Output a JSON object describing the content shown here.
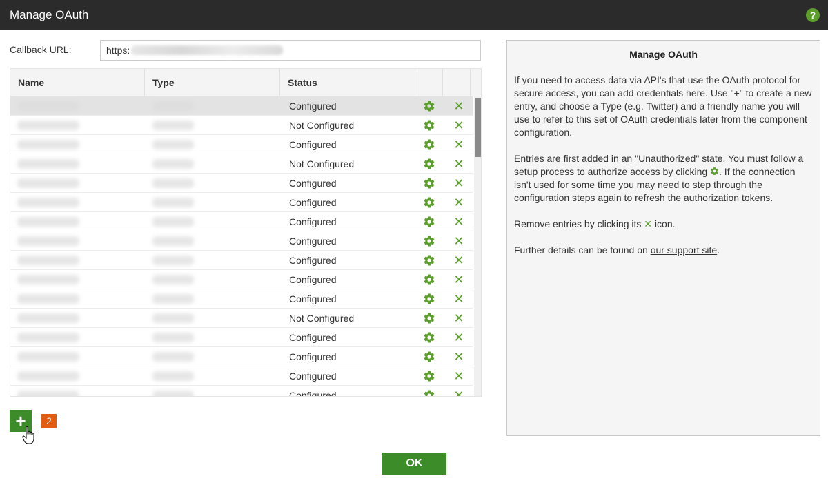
{
  "dialog": {
    "title": "Manage OAuth"
  },
  "callback": {
    "label": "Callback URL:",
    "value": "https:"
  },
  "grid": {
    "columns": [
      "Name",
      "Type",
      "Status"
    ],
    "rows": [
      {
        "status": "Configured",
        "selected": true
      },
      {
        "status": "Not Configured"
      },
      {
        "status": "Configured"
      },
      {
        "status": "Not Configured"
      },
      {
        "status": "Configured"
      },
      {
        "status": "Configured"
      },
      {
        "status": "Configured"
      },
      {
        "status": "Configured"
      },
      {
        "status": "Configured"
      },
      {
        "status": "Configured"
      },
      {
        "status": "Configured"
      },
      {
        "status": "Not Configured"
      },
      {
        "status": "Configured"
      },
      {
        "status": "Configured"
      },
      {
        "status": "Configured"
      },
      {
        "status": "Configured"
      }
    ]
  },
  "badge": {
    "count": "2"
  },
  "help": {
    "title": "Manage OAuth",
    "p1": "If you need to access data via API's that use the OAuth protocol for secure access, you can add credentials here. Use \"+\" to create a new entry, and choose a Type (e.g. Twitter) and a friendly name you will use to refer to this set of OAuth credentials later from the component configuration.",
    "p2_before": "Entries are first added in an \"Unauthorized\" state. You must follow a setup process to authorize access by clicking",
    "p2_after": ". If the connection isn't used for some time you may need to step through the configuration steps again to refresh the authorization tokens.",
    "p3_before": "Remove entries by clicking its",
    "p3_after": "icon.",
    "p4_before": "Further details can be found on",
    "p4_link": "our support site",
    "p4_after": "."
  },
  "buttons": {
    "ok": "OK",
    "add": "+"
  },
  "colors": {
    "accent": "#3d8c2a",
    "icon_green": "#5b9e2c",
    "badge": "#e35c10",
    "titlebar": "#2b2b2b"
  }
}
